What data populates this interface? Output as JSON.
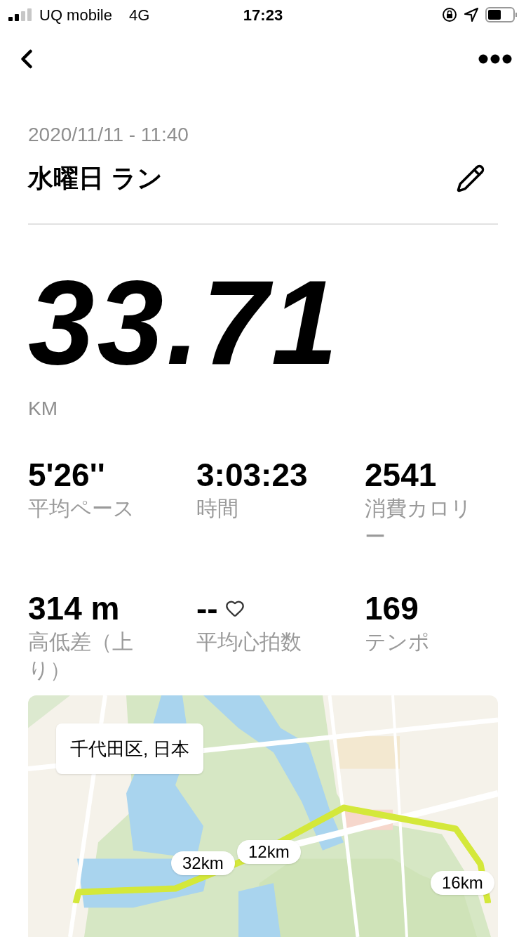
{
  "status_bar": {
    "carrier": "UQ mobile",
    "network": "4G",
    "time": "17:23"
  },
  "activity": {
    "date": "2020/11/11 - 11:40",
    "title": "水曜日 ラン"
  },
  "distance": {
    "value": "33.71",
    "unit": "KM"
  },
  "stats": [
    {
      "kind": "plain",
      "value": "5'26''",
      "label": "平均ペース"
    },
    {
      "kind": "plain",
      "value": "3:03:23",
      "label": "時間"
    },
    {
      "kind": "plain",
      "value": "2541",
      "label": "消費カロリー"
    },
    {
      "kind": "plain",
      "value": "314 m",
      "label": "高低差（上り）"
    },
    {
      "kind": "heart",
      "value": "--",
      "label": "平均心拍数"
    },
    {
      "kind": "plain",
      "value": "169",
      "label": "テンポ"
    }
  ],
  "map": {
    "location": "千代田区, 日本",
    "markers": [
      {
        "label": "32km"
      },
      {
        "label": "12km"
      },
      {
        "label": "16km"
      }
    ]
  }
}
